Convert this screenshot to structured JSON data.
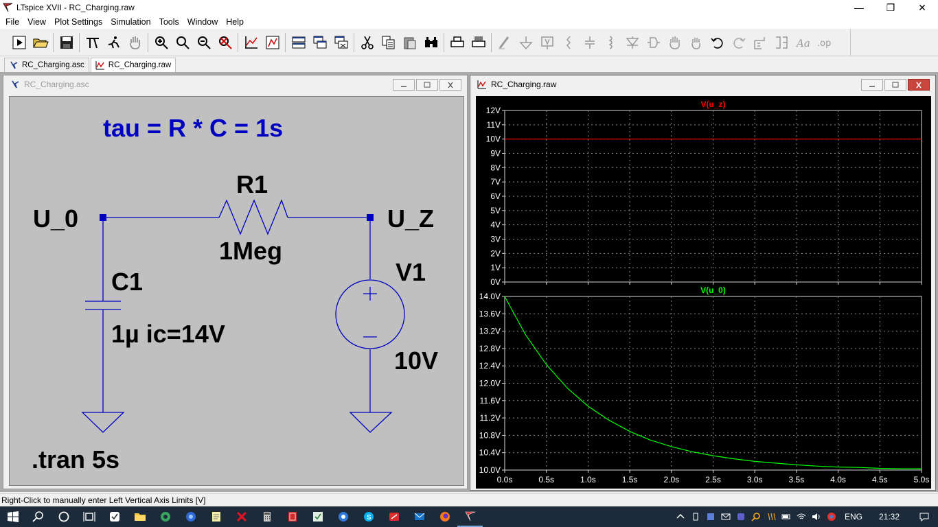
{
  "app": {
    "title": "LTspice XVII - RC_Charging.raw",
    "window_controls": {
      "minimize": "—",
      "restore": "❐",
      "close": "✕"
    }
  },
  "menu": [
    "File",
    "View",
    "Plot Settings",
    "Simulation",
    "Tools",
    "Window",
    "Help"
  ],
  "toolbar": {
    "groups": [
      [
        "run-icon",
        "open-icon"
      ],
      [
        "save-icon"
      ],
      [
        "control-panel-icon",
        "halt-icon",
        "pan-icon"
      ],
      [
        "zoom-in-icon",
        "zoom-area-icon",
        "zoom-out-icon",
        "zoom-fit-icon"
      ],
      [
        "autorange-icon",
        "tile-icon"
      ],
      [
        "tile-horizontal-icon",
        "cascade-icon",
        "close-all-icon"
      ],
      [
        "cut-icon",
        "copy-icon",
        "paste-icon",
        "find-icon"
      ],
      [
        "print-icon",
        "print-setup-icon"
      ],
      [
        "wire-icon",
        "ground-icon",
        "label-net-icon",
        "resistor-icon",
        "capacitor-icon",
        "inductor-icon",
        "diode-icon",
        "component-icon",
        "move-icon",
        "drag-icon",
        "undo-icon",
        "redo-icon",
        "rotate-icon",
        "mirror-icon",
        "text-icon",
        "spice-directive-icon"
      ]
    ]
  },
  "tabs": [
    {
      "label": "RC_Charging.asc",
      "kind": "schematic",
      "active": false
    },
    {
      "label": "RC_Charging.raw",
      "kind": "waveform",
      "active": true
    }
  ],
  "schematic": {
    "window_title": "RC_Charging.asc",
    "comment": "tau = R * C = 1s",
    "nodes": {
      "left": "U_0",
      "right": "U_Z"
    },
    "resistor": {
      "name": "R1",
      "value": "1Meg"
    },
    "capacitor": {
      "name": "C1",
      "value": "1µ ic=14V"
    },
    "source": {
      "name": "V1",
      "value": "10V"
    },
    "directive": ".tran 5s",
    "colors": {
      "wire": "#0000c0",
      "text": "#000000",
      "comment": "#0000c0",
      "background": "#c0c0c0"
    }
  },
  "waveform": {
    "window_title": "RC_Charging.raw"
  },
  "chart_data": [
    {
      "type": "line",
      "title": "V(u_z)",
      "color": "#ff0000",
      "x": [
        0,
        0.5,
        1,
        1.5,
        2,
        2.5,
        3,
        3.5,
        4,
        4.5,
        5
      ],
      "series": [
        {
          "name": "V(u_z)",
          "values": [
            10,
            10,
            10,
            10,
            10,
            10,
            10,
            10,
            10,
            10,
            10
          ]
        }
      ],
      "ylim": [
        0,
        12
      ],
      "ytick_labels": [
        "12V",
        "11V",
        "10V",
        "9V",
        "8V",
        "7V",
        "6V",
        "5V",
        "4V",
        "3V",
        "2V",
        "1V",
        "0V"
      ],
      "grid": true
    },
    {
      "type": "line",
      "title": "V(u_0)",
      "color": "#00ff00",
      "x": [
        0,
        0.25,
        0.5,
        0.75,
        1,
        1.25,
        1.5,
        1.75,
        2,
        2.25,
        2.5,
        2.75,
        3,
        3.25,
        3.5,
        3.75,
        4,
        4.25,
        4.5,
        4.75,
        5
      ],
      "series": [
        {
          "name": "V(u_0)",
          "values": [
            14.0,
            13.12,
            12.43,
            11.89,
            11.47,
            11.15,
            10.89,
            10.69,
            10.54,
            10.42,
            10.33,
            10.26,
            10.2,
            10.16,
            10.12,
            10.09,
            10.07,
            10.06,
            10.04,
            10.03,
            10.03
          ]
        }
      ],
      "ylim": [
        10,
        14
      ],
      "ytick_labels": [
        "14.0V",
        "13.6V",
        "13.2V",
        "12.8V",
        "12.4V",
        "12.0V",
        "11.6V",
        "11.2V",
        "10.8V",
        "10.4V",
        "10.0V"
      ],
      "xlim": [
        0,
        5
      ],
      "xtick_labels": [
        "0.0s",
        "0.5s",
        "1.0s",
        "1.5s",
        "2.0s",
        "2.5s",
        "3.0s",
        "3.5s",
        "4.0s",
        "4.5s",
        "5.0s"
      ],
      "grid": true
    }
  ],
  "status": "Right-Click to manually enter Left Vertical Axis Limits [V]",
  "taskbar": {
    "apps": [
      "start-icon",
      "search-icon",
      "cortana-icon",
      "task-view-icon",
      "app-icon-1",
      "file-explorer-icon",
      "app-icon-2",
      "app-icon-3",
      "notepad-icon",
      "app-icon-4",
      "calculator-icon",
      "app-icon-5",
      "app-icon-6",
      "app-icon-7",
      "skype-icon",
      "app-icon-8",
      "outlook-icon",
      "firefox-icon",
      "ltspice-icon"
    ],
    "language": "ENG",
    "clock": "21:32"
  }
}
